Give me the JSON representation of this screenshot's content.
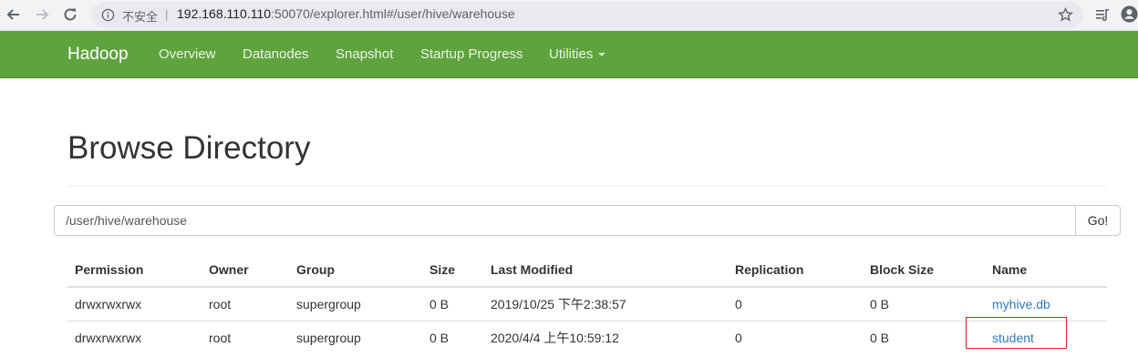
{
  "browser": {
    "security_label": "不安全",
    "separator": "|",
    "url_host": "192.168.110.110",
    "url_rest": ":50070/explorer.html#/user/hive/warehouse"
  },
  "navbar": {
    "brand": "Hadoop",
    "items": [
      "Overview",
      "Datanodes",
      "Snapshot",
      "Startup Progress",
      "Utilities"
    ]
  },
  "page": {
    "title": "Browse Directory"
  },
  "directory": {
    "value": "/user/hive/warehouse",
    "go_label": "Go!"
  },
  "table": {
    "headers": [
      "Permission",
      "Owner",
      "Group",
      "Size",
      "Last Modified",
      "Replication",
      "Block Size",
      "Name"
    ],
    "rows": [
      {
        "permission": "drwxrwxrwx",
        "owner": "root",
        "group": "supergroup",
        "size": "0 B",
        "modified": "2019/10/25 下午2:38:57",
        "replication": "0",
        "block_size": "0 B",
        "name": "myhive.db"
      },
      {
        "permission": "drwxrwxrwx",
        "owner": "root",
        "group": "supergroup",
        "size": "0 B",
        "modified": "2020/4/4 上午10:59:12",
        "replication": "0",
        "block_size": "0 B",
        "name": "student"
      }
    ]
  },
  "colors": {
    "navbar": "#5fa33e",
    "link": "#337ab7",
    "highlight_box": "#e02020"
  }
}
